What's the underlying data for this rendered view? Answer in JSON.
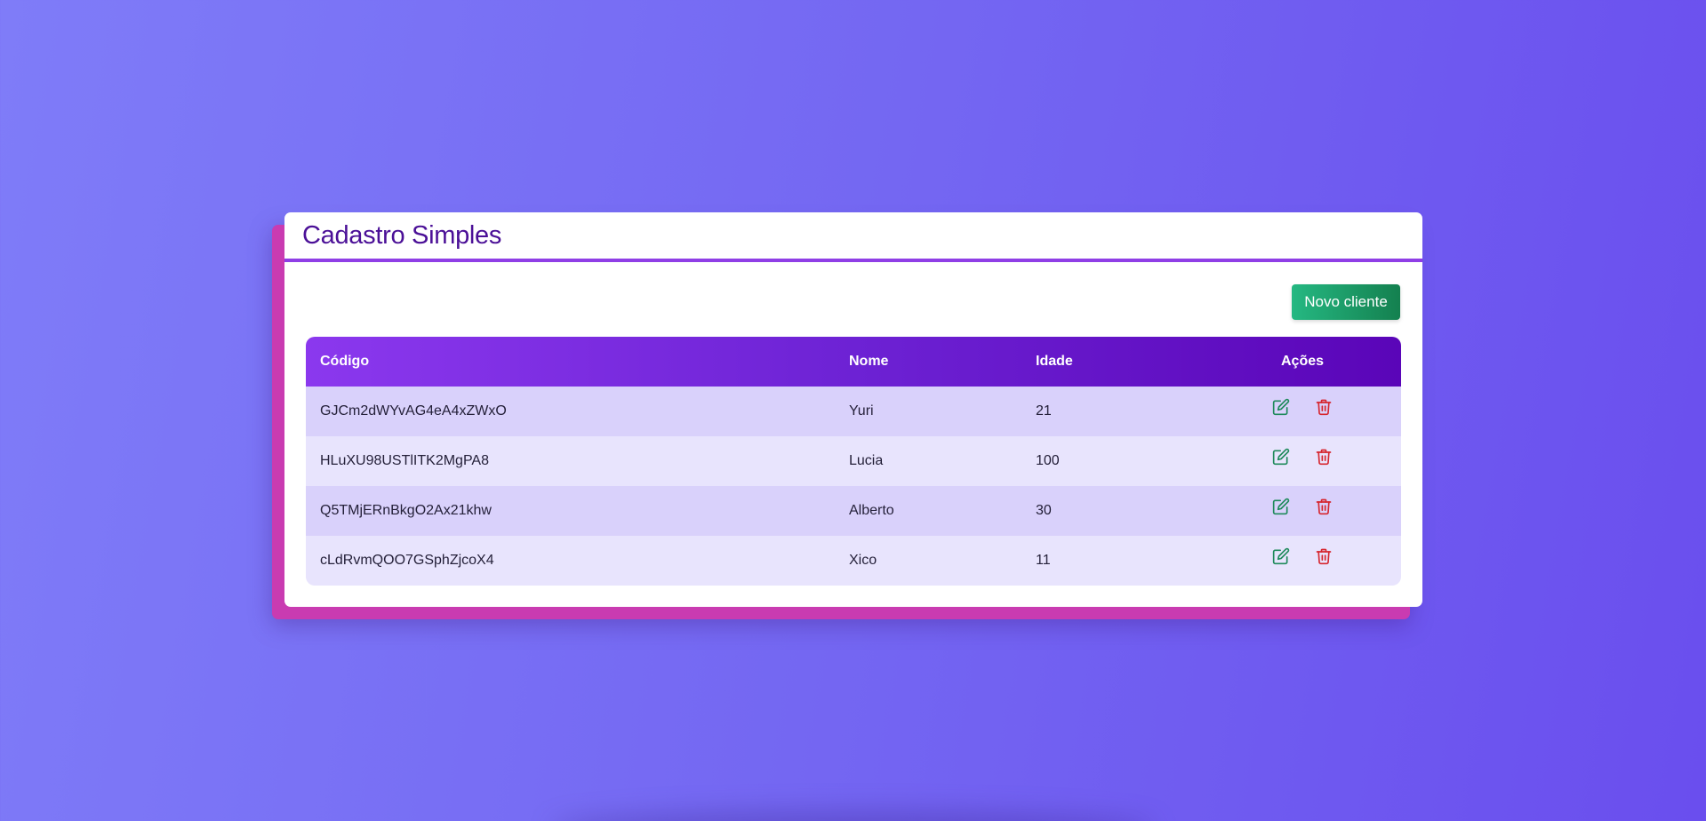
{
  "header": {
    "title": "Cadastro Simples"
  },
  "toolbar": {
    "new_client_label": "Novo cliente"
  },
  "table": {
    "columns": {
      "code": "Código",
      "name": "Nome",
      "age": "Idade",
      "actions": "Ações"
    },
    "rows": [
      {
        "code": "GJCm2dWYvAG4eA4xZWxO",
        "name": "Yuri",
        "age": "21"
      },
      {
        "code": "HLuXU98USTlITK2MgPA8",
        "name": "Lucia",
        "age": "100"
      },
      {
        "code": "Q5TMjERnBkgO2Ax21khw",
        "name": "Alberto",
        "age": "30"
      },
      {
        "code": "cLdRvmQOO7GSphZjcoX4",
        "name": "Xico",
        "age": "11"
      }
    ],
    "row_actions": [
      "edit-icon",
      "trash-icon"
    ]
  },
  "colors": {
    "title": "#4b1097",
    "header_gradient_start": "#8b38ee",
    "header_gradient_end": "#5a05b8",
    "new_button": "#1f9d6b",
    "edit_icon": "#1f8a5c",
    "delete_icon": "#d6262f",
    "row_odd": "#d9d1fb",
    "row_even": "#e8e4fd"
  }
}
